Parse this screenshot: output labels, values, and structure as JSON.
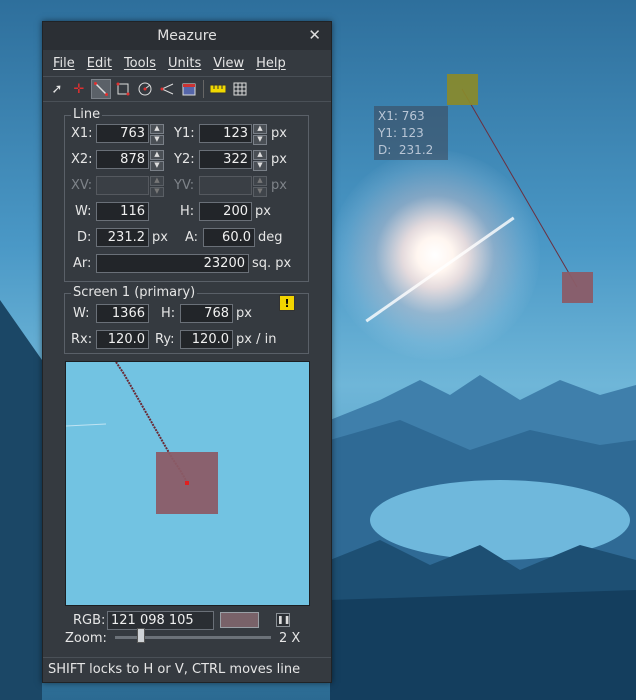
{
  "window": {
    "title": "Meazure"
  },
  "menu": [
    "File",
    "Edit",
    "Tools",
    "Units",
    "View",
    "Help"
  ],
  "toolbar_icons": [
    "cursor-tool-icon",
    "point-tool-icon",
    "line-tool-icon",
    "rectangle-tool-icon",
    "circle-tool-icon",
    "angle-tool-icon",
    "window-tool-icon",
    "ruler-icon",
    "grid-icon"
  ],
  "line_group": {
    "legend": "Line",
    "x1_label": "X1:",
    "x1": "763",
    "y1_label": "Y1:",
    "y1": "123",
    "x2_label": "X2:",
    "x2": "878",
    "y2_label": "Y2:",
    "y2": "322",
    "xv_label": "XV:",
    "xv": "",
    "yv_label": "YV:",
    "yv": "",
    "w_label": "W:",
    "w": "116",
    "h_label": "H:",
    "h": "200",
    "d_label": "D:",
    "d": "231.2",
    "a_label": "A:",
    "a": "60.0",
    "ar_label": "Ar:",
    "ar": "23200",
    "unit_px": "px",
    "unit_deg": "deg",
    "unit_sqpx": "sq. px"
  },
  "screen_group": {
    "legend": "Screen 1 (primary)",
    "w_label": "W:",
    "w": "1366",
    "h_label": "H:",
    "h": "768",
    "rx_label": "Rx:",
    "rx": "120.0",
    "ry_label": "Ry:",
    "ry": "120.0",
    "unit_px": "px",
    "unit_pxin": "px / in"
  },
  "rgb": {
    "label": "RGB:",
    "value": "121 098 105",
    "swatch_color": "#796269"
  },
  "zoom": {
    "label": "Zoom:",
    "value": "2 X",
    "level_fraction": 0.15
  },
  "status_text": "SHIFT locks to H or V, CTRL moves line",
  "overlay_info": {
    "x1": "X1: 763",
    "y1": "Y1: 123",
    "d": "D:  231.2"
  },
  "colors": {
    "point1": "#8a8a2a",
    "point2": "#8b5c67",
    "window_bg": "#353a40"
  }
}
